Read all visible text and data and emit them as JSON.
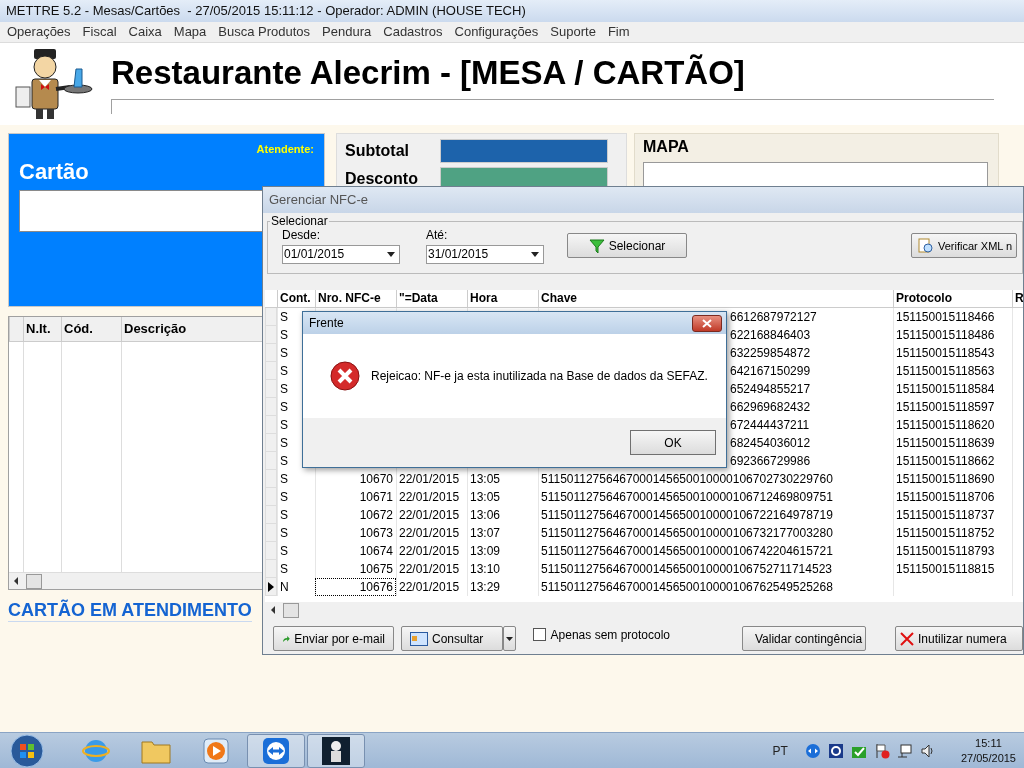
{
  "window": {
    "title": "METTRE 5.2 - Mesas/Cartões  - 27/05/2015 15:11:12 - Operador: ADMIN (HOUSE TECH)"
  },
  "menu": [
    "Operações",
    "Fiscal",
    "Caixa",
    "Mapa",
    "Busca Produtos",
    "Pendura",
    "Cadastros",
    "Configurações",
    "Suporte",
    "Fim"
  ],
  "header": {
    "title": "Restaurante Alecrim - [MESA / CARTÃO]"
  },
  "card_panel": {
    "attendant_label": "Atendente:",
    "title": "Cartão"
  },
  "items_table": {
    "columns": [
      "N.It.",
      "Cód.",
      "Descrição"
    ]
  },
  "status_text": "CARTÃO EM ATENDIMENTO",
  "totals": [
    {
      "label": "Subtotal",
      "color": "#1d63ab"
    },
    {
      "label": "Desconto",
      "color": "#4fa283"
    }
  ],
  "map_panel": {
    "title": "MAPA"
  },
  "nfce_window": {
    "title": "Gerenciar NFC-e",
    "group": "Selecionar",
    "from": {
      "label": "Desde:",
      "value": "01/01/2015"
    },
    "to": {
      "label": "Até:",
      "value": "31/01/2015"
    },
    "select_button": "Selecionar",
    "verify_button": "Verificar XML n",
    "columns": [
      "Cont.",
      "Nro. NFC-e",
      "\"=Data",
      "Hora",
      "Chave",
      "Protocolo",
      "R"
    ],
    "rows": [
      {
        "kind": "covered",
        "cont": "S",
        "chave": "6612687972127",
        "protocolo": "151150015118466",
        "selected": false
      },
      {
        "kind": "covered",
        "cont": "S",
        "chave": "622168846403",
        "protocolo": "151150015118486",
        "selected": false
      },
      {
        "kind": "covered",
        "cont": "S",
        "chave": "632259854872",
        "protocolo": "151150015118543",
        "selected": false
      },
      {
        "kind": "covered",
        "cont": "S",
        "chave": "642167150299",
        "protocolo": "151150015118563",
        "selected": false
      },
      {
        "kind": "covered",
        "cont": "S",
        "chave": "652494855217",
        "protocolo": "151150015118584",
        "selected": false
      },
      {
        "kind": "covered",
        "cont": "S",
        "chave": "662969682432",
        "protocolo": "151150015118597",
        "selected": false
      },
      {
        "kind": "covered",
        "cont": "S",
        "chave": "672444437211",
        "protocolo": "151150015118620",
        "selected": false
      },
      {
        "kind": "covered",
        "cont": "S",
        "chave": "682454036012",
        "protocolo": "151150015118639",
        "selected": false
      },
      {
        "kind": "covered",
        "cont": "S",
        "chave": "692366729986",
        "protocolo": "151150015118662",
        "selected": false
      },
      {
        "kind": "full",
        "cont": "S",
        "nro": "10670",
        "data": "22/01/2015",
        "hora": "13:05",
        "chave": "51150112756467000145650010000106702730229760",
        "protocolo": "151150015118690",
        "selected": false
      },
      {
        "kind": "full",
        "cont": "S",
        "nro": "10671",
        "data": "22/01/2015",
        "hora": "13:05",
        "chave": "51150112756467000145650010000106712469809751",
        "protocolo": "151150015118706",
        "selected": false
      },
      {
        "kind": "full",
        "cont": "S",
        "nro": "10672",
        "data": "22/01/2015",
        "hora": "13:06",
        "chave": "51150112756467000145650010000106722164978719",
        "protocolo": "151150015118737",
        "selected": false
      },
      {
        "kind": "full",
        "cont": "S",
        "nro": "10673",
        "data": "22/01/2015",
        "hora": "13:07",
        "chave": "51150112756467000145650010000106732177003280",
        "protocolo": "151150015118752",
        "selected": false
      },
      {
        "kind": "full",
        "cont": "S",
        "nro": "10674",
        "data": "22/01/2015",
        "hora": "13:09",
        "chave": "51150112756467000145650010000106742204615721",
        "protocolo": "151150015118793",
        "selected": false
      },
      {
        "kind": "full",
        "cont": "S",
        "nro": "10675",
        "data": "22/01/2015",
        "hora": "13:10",
        "chave": "51150112756467000145650010000106752711714523",
        "protocolo": "151150015118815",
        "selected": false
      },
      {
        "kind": "full",
        "cont": "N",
        "nro": "10676",
        "data": "22/01/2015",
        "hora": "13:29",
        "chave": "51150112756467000145650010000106762549525268",
        "selected": true
      }
    ],
    "email_button": "Enviar por e-mail",
    "query_button": "Consultar",
    "only_without_protocol": {
      "label": "Apenas sem protocolo",
      "checked": false
    },
    "contingency_button": "Validar contingência",
    "void_button": "Inutilizar numera"
  },
  "dialog": {
    "title": "Frente",
    "message": "Rejeicao: NF-e ja esta inutilizada na Base de dados da SEFAZ.",
    "ok_button": "OK"
  },
  "taskbar": {
    "apps": [
      {
        "kind": "browser",
        "selected": false
      },
      {
        "kind": "folder",
        "selected": false
      },
      {
        "kind": "media",
        "selected": false
      },
      {
        "kind": "remote",
        "selected": true
      },
      {
        "kind": "restaurant",
        "selected": true
      }
    ],
    "language": "PT",
    "time": "15:11",
    "date": "27/05/2015"
  }
}
